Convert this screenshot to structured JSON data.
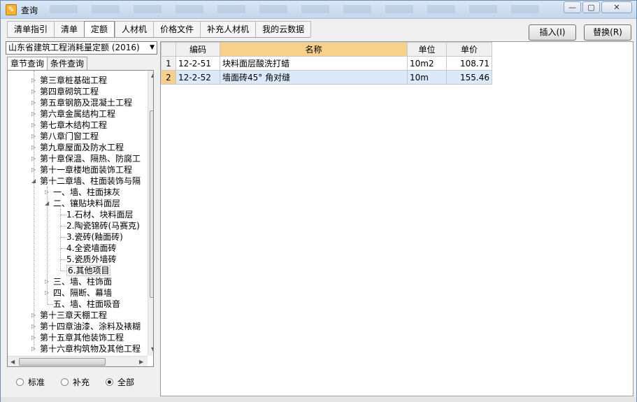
{
  "window": {
    "title": "查询"
  },
  "tabs": [
    "清单指引",
    "清单",
    "定额",
    "人材机",
    "价格文件",
    "补充人材机",
    "我的云数据"
  ],
  "active_tab": "定额",
  "buttons": {
    "insert": "插入(I)",
    "replace": "替换(R)"
  },
  "quota_select": "山东省建筑工程消耗量定额 (2016)",
  "subtabs": [
    "章节查询",
    "条件查询"
  ],
  "tree": [
    "第三章桩基础工程",
    "第四章砌筑工程",
    "第五章钢筋及混凝土工程",
    "第六章金属结构工程",
    "第七章木结构工程",
    "第八章门窗工程",
    "第九章屋面及防水工程",
    "第十章保温、隔热、防腐工",
    "第十一章楼地面装饰工程",
    "第十二章墙、柱面装饰与隔",
    "一、墙、柱面抹灰",
    "二、镶贴块料面层",
    "1.石材、块料面层",
    "2.陶瓷锦砖(马赛克)",
    "3.瓷砖(釉面砖)",
    "4.全瓷墙面砖",
    "5.瓷质外墙砖",
    "6.其他项目",
    "三、墙、柱饰面",
    "四、隔断、幕墙",
    "五、墙、柱面吸音",
    "第十三章天棚工程",
    "第十四章油漆、涂料及裱糊",
    "第十五章其他装饰工程",
    "第十六章构筑物及其他工程"
  ],
  "radios": {
    "standard": "标准",
    "supplement": "补充",
    "all": "全部"
  },
  "grid": {
    "headers": [
      "编码",
      "名称",
      "单位",
      "单价"
    ],
    "rows": [
      {
        "idx": "1",
        "code": "12-2-51",
        "name": "块料面层酸洗打蜡",
        "unit": "10m2",
        "price": "108.71"
      },
      {
        "idx": "2",
        "code": "12-2-52",
        "name": "墙面砖45° 角对缝",
        "unit": "10m",
        "price": "155.46"
      }
    ]
  }
}
